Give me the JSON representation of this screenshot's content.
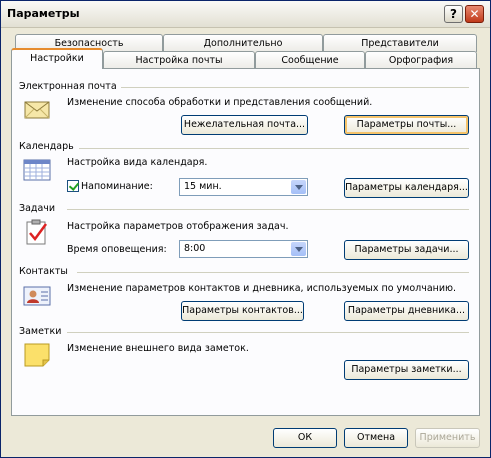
{
  "window": {
    "title": "Параметры",
    "help_glyph": "?",
    "close_glyph": "✕"
  },
  "tabs_back": [
    "Безопасность",
    "Дополнительно",
    "Представители"
  ],
  "tabs_front": [
    "Настройки",
    "Настройка почты",
    "Сообщение",
    "Орфография"
  ],
  "sections": {
    "mail": {
      "title": "Электронная почта",
      "description": "Изменение способа обработки и представления сообщений.",
      "junk_button": "Нежелательная почта...",
      "options_button": "Параметры почты..."
    },
    "calendar": {
      "title": "Календарь",
      "description": "Настройка вида календаря.",
      "reminder_label": "Напоминание:",
      "reminder_value": "15 мин.",
      "options_button": "Параметры календаря..."
    },
    "tasks": {
      "title": "Задачи",
      "description": "Настройка параметров отображения задач.",
      "time_label": "Время оповещения:",
      "time_value": "8:00",
      "options_button": "Параметры задачи..."
    },
    "contacts": {
      "title": "Контакты",
      "description": "Изменение параметров контактов и дневника, используемых по умолчанию.",
      "contacts_button": "Параметры контактов...",
      "journal_button": "Параметры дневника..."
    },
    "notes": {
      "title": "Заметки",
      "description": "Изменение внешнего вида заметок.",
      "options_button": "Параметры заметки..."
    }
  },
  "footer": {
    "ok": "ОК",
    "cancel": "Отмена",
    "apply": "Применить"
  },
  "icons": [
    "envelope-icon",
    "calendar-icon",
    "task-checklist-icon",
    "contact-card-icon",
    "sticky-note-icon"
  ]
}
